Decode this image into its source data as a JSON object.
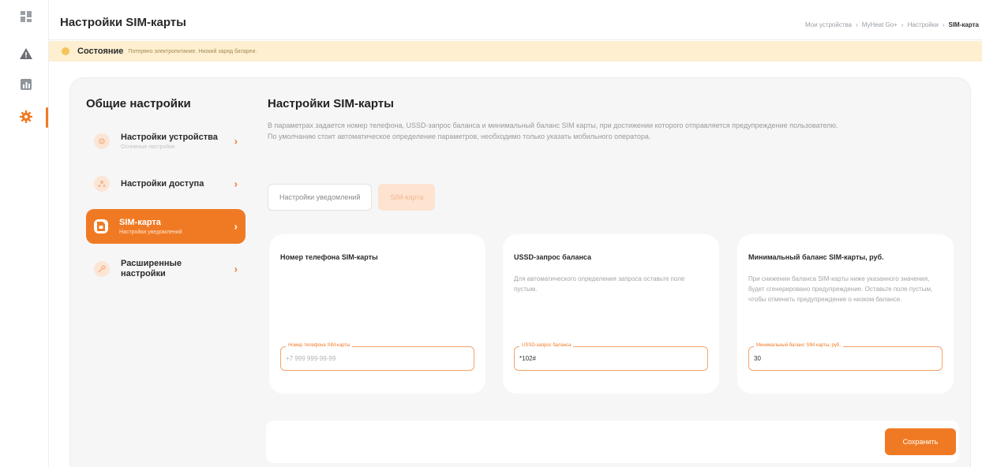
{
  "rail": {
    "icons": [
      "dashboard-icon",
      "alert-icon",
      "stats-icon",
      "settings-icon"
    ],
    "active": "settings-icon"
  },
  "header": {
    "title": "Настройки SIM-карты",
    "breadcrumb": [
      "Мои устройства",
      "MyHeat Go+",
      "Настройки",
      "SIM-карта"
    ]
  },
  "status": {
    "label": "Состояние",
    "text": "Потеряно электропитание. Низкий заряд батареи.",
    "color": "#fdefd0"
  },
  "sidebar": {
    "title": "Общие настройки",
    "items": [
      {
        "label": "Настройки устройства",
        "sub": "Основные настройки",
        "icon": "gear-icon"
      },
      {
        "label": "Настройки доступа",
        "sub": "",
        "icon": "users-icon"
      },
      {
        "label": "SIM-карта",
        "sub": "Настройки уведомлений",
        "icon": "sim-card-icon"
      },
      {
        "label": "Расширенные настройки",
        "sub": "",
        "icon": "tools-icon"
      }
    ]
  },
  "content": {
    "title": "Настройки SIM-карты",
    "desc_line1": "В параметрах задается номер телефона, USSD-запрос баланса и минимальный баланс SIM карты, при достижении которого отправляется предупреждение пользователю.",
    "desc_line2": "По умолчанию стоит автоматическое определение параметров, необходимо только указать мобильного оператора."
  },
  "tabs": [
    {
      "label": "Настройки уведомлений"
    },
    {
      "label": "SIM-карта"
    }
  ],
  "fields": [
    {
      "title": "Номер телефона SIM-карты",
      "desc": "",
      "legend": "Номер телефона SIM-карты",
      "value": "",
      "placeholder": "+7 999 999-99-99"
    },
    {
      "title": "USSD-запрос баланса",
      "desc": "Для автоматического определения запроса оставьте поле пустым.",
      "legend": "USSD-запрос баланса",
      "value": "*102#",
      "placeholder": ""
    },
    {
      "title": "Минимальный баланс SIM-карты, руб.",
      "desc": "При снижении баланса SIM-карты ниже указанного значения, будет сгенерировано предупреждение. Оставьте поле пустым, чтобы отменить предупреждение о низком балансе.",
      "legend": "Минимальный баланс SIM-карты, руб.",
      "value": "30",
      "placeholder": ""
    }
  ],
  "actions": {
    "save_label": "Сохранить"
  },
  "colors": {
    "accent": "#f07a24",
    "status_bg": "#fdefd0"
  }
}
